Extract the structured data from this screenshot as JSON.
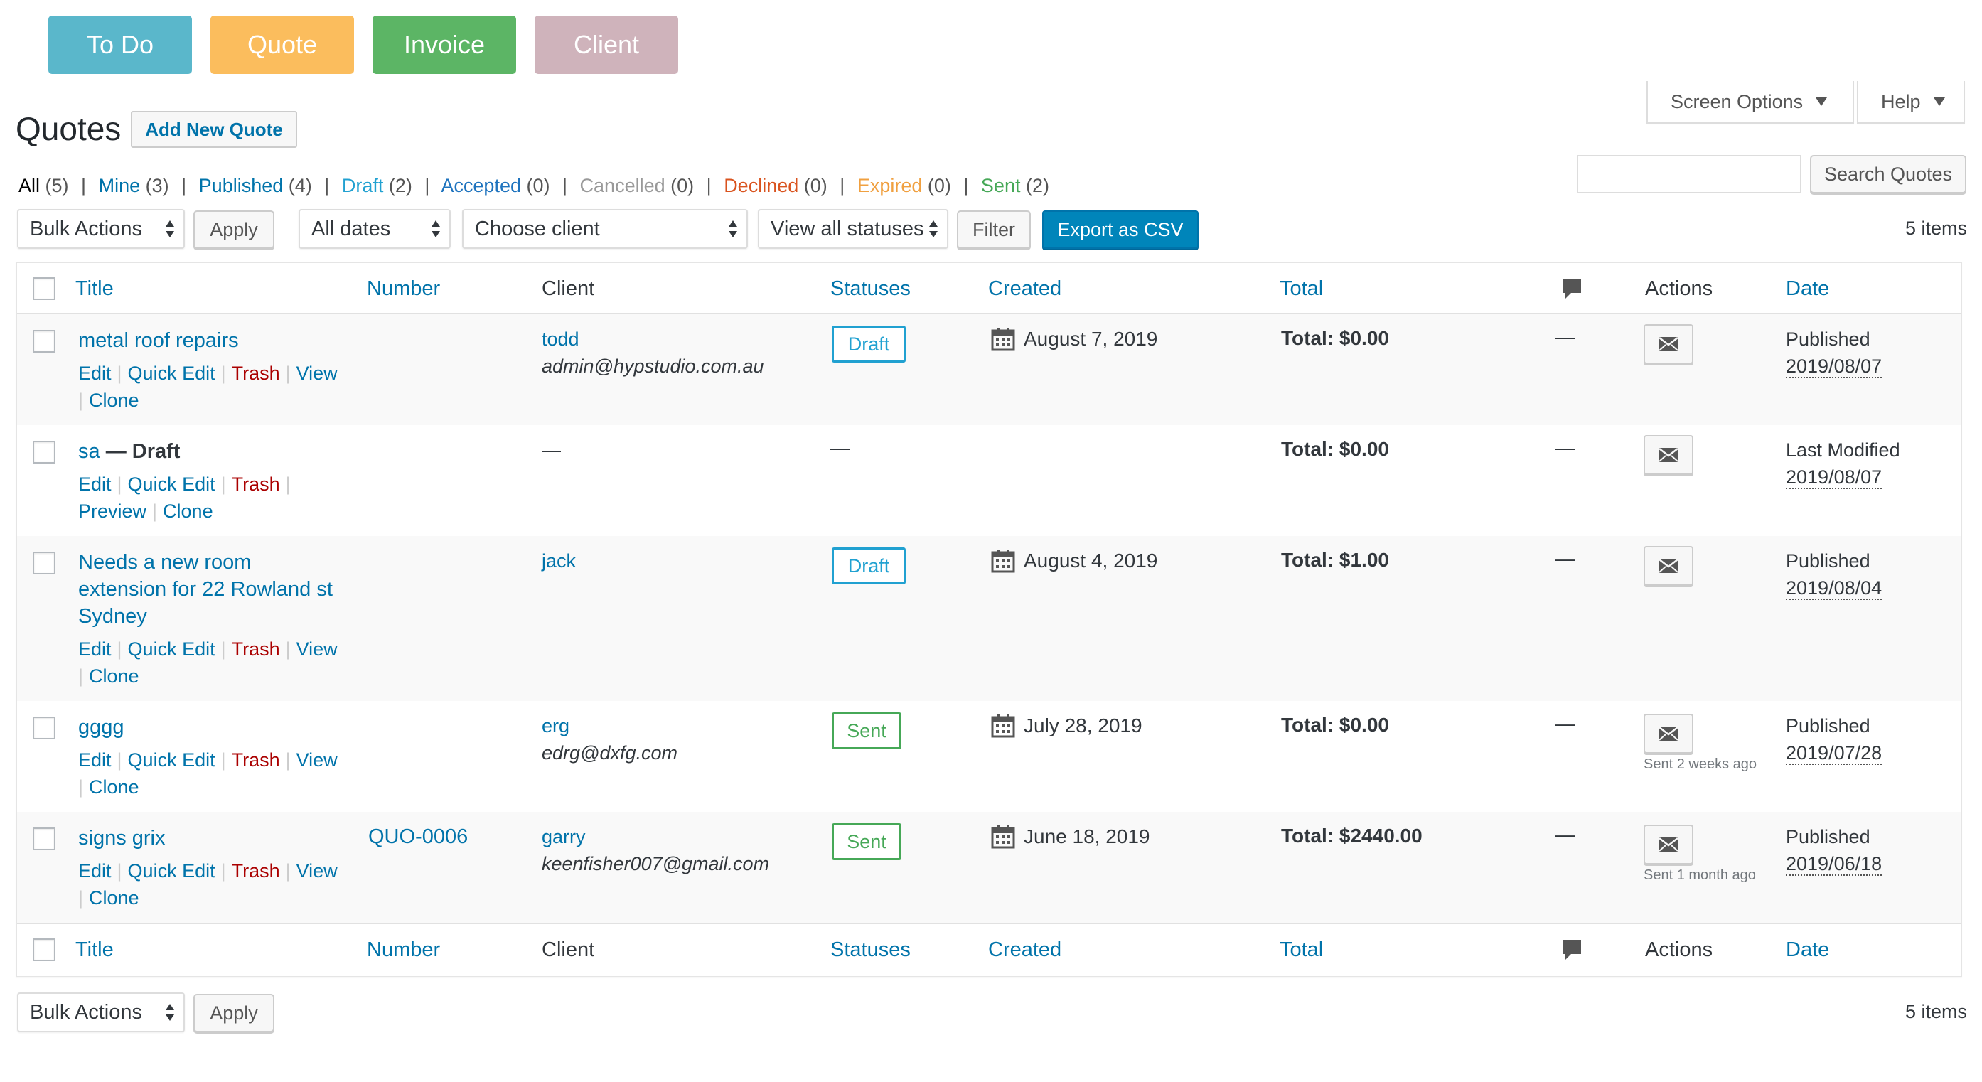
{
  "top_buttons": [
    {
      "label": "To Do",
      "color": "#5ab7cb"
    },
    {
      "label": "Quote",
      "color": "#fbbd5d"
    },
    {
      "label": "Invoice",
      "color": "#5cb565"
    },
    {
      "label": "Client",
      "color": "#cfb3bb"
    }
  ],
  "header": {
    "title": "Quotes",
    "add_new": "Add New Quote",
    "screen_options": "Screen Options",
    "help": "Help"
  },
  "filters": {
    "all": {
      "label": "All",
      "count": "(5)"
    },
    "mine": {
      "label": "Mine",
      "count": "(3)"
    },
    "published": {
      "label": "Published",
      "count": "(4)"
    },
    "draft": {
      "label": "Draft",
      "count": "(2)"
    },
    "accepted": {
      "label": "Accepted",
      "count": "(0)"
    },
    "cancelled": {
      "label": "Cancelled",
      "count": "(0)"
    },
    "declined": {
      "label": "Declined",
      "count": "(0)"
    },
    "expired": {
      "label": "Expired",
      "count": "(0)"
    },
    "sent": {
      "label": "Sent",
      "count": "(2)"
    }
  },
  "search": {
    "value": "",
    "button": "Search Quotes"
  },
  "toolbar": {
    "bulk_actions": "Bulk Actions",
    "apply": "Apply",
    "all_dates": "All dates",
    "choose_client": "Choose client",
    "view_all_statuses": "View all statuses",
    "filter": "Filter",
    "export_csv": "Export as CSV",
    "items_count": "5 items"
  },
  "columns": {
    "title": "Title",
    "number": "Number",
    "client": "Client",
    "statuses": "Statuses",
    "created": "Created",
    "total": "Total",
    "actions": "Actions",
    "date": "Date"
  },
  "row_actions": {
    "edit": "Edit",
    "quick_edit": "Quick Edit",
    "trash": "Trash",
    "view": "View",
    "preview": "Preview",
    "clone": "Clone"
  },
  "rows": [
    {
      "title": "metal roof repairs",
      "number": "",
      "client_name": "todd",
      "client_email": "admin@hypstudio.com.au",
      "status": "Draft",
      "created": "August 7, 2019",
      "total": "Total: $0.00",
      "comments": "—",
      "sent_note": "",
      "date_status": "Published",
      "date": "2019/08/07"
    },
    {
      "title": "sa",
      "title_suffix": "— Draft",
      "number": "",
      "client_name": "—",
      "client_email": "",
      "status": "",
      "status_dash": "—",
      "created": "",
      "total": "Total: $0.00",
      "comments": "—",
      "sent_note": "",
      "date_status": "Last Modified",
      "date": "2019/08/07"
    },
    {
      "title_lines": [
        "Needs a new room",
        "extension for 22 Rowland st",
        "Sydney"
      ],
      "number": "",
      "client_name": "jack",
      "client_email": "",
      "status": "Draft",
      "created": "August 4, 2019",
      "total": "Total: $1.00",
      "comments": "—",
      "sent_note": "",
      "date_status": "Published",
      "date": "2019/08/04"
    },
    {
      "title": "gggg",
      "number": "",
      "client_name": "erg",
      "client_email": "edrg@dxfg.com",
      "status": "Sent",
      "created": "July 28, 2019",
      "total": "Total: $0.00",
      "comments": "—",
      "sent_note": "Sent 2 weeks ago",
      "date_status": "Published",
      "date": "2019/07/28"
    },
    {
      "title": "signs grix",
      "number": "QUO-0006",
      "client_name": "garry",
      "client_email": "keenfisher007@gmail.com",
      "status": "Sent",
      "created": "June 18, 2019",
      "total": "Total: $2440.00",
      "comments": "—",
      "sent_note": "Sent 1 month ago",
      "date_status": "Published",
      "date": "2019/06/18"
    }
  ],
  "colors": {
    "link": "#0073aa",
    "trash": "#a00000",
    "draft": "#21a1d1",
    "accepted": "#1e73be",
    "cancelled": "#999999",
    "declined": "#d9531e",
    "expired": "#f0a040",
    "sent": "#46a857",
    "primary_button": "#0085ba"
  }
}
